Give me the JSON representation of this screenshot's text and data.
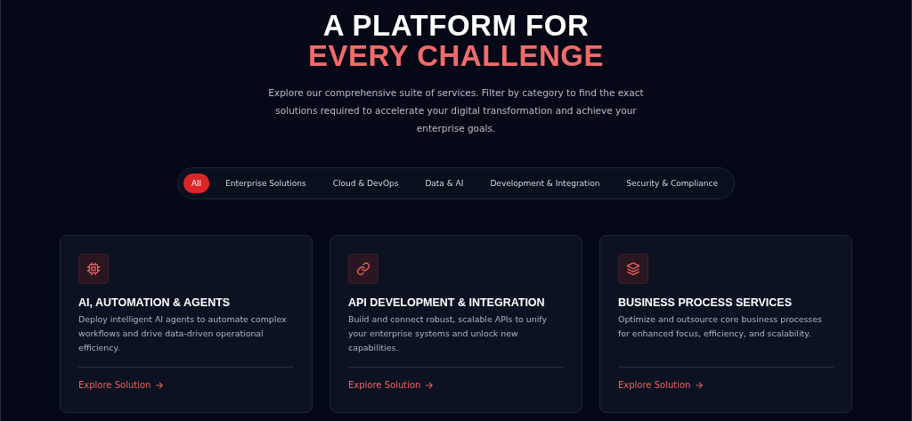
{
  "heading": {
    "line_1": "A PLATFORM FOR",
    "line_2": "EVERY CHALLENGE"
  },
  "intro": "Explore our comprehensive suite of services. Filter by category to find the exact solutions required to accelerate your digital transformation and achieve your enterprise goals.",
  "filters": [
    {
      "label": "All",
      "selected": true
    },
    {
      "label": "Enterprise Solutions",
      "selected": false
    },
    {
      "label": "Cloud & DevOps",
      "selected": false
    },
    {
      "label": "Data & AI",
      "selected": false
    },
    {
      "label": "Development & Integration",
      "selected": false
    },
    {
      "label": "Security & Compliance",
      "selected": false
    }
  ],
  "cards": [
    {
      "title": "AI, AUTOMATION & AGENTS",
      "description": "Deploy intelligent AI agents to automate complex workflows and drive data-driven operational efficiency.",
      "link": "Explore Solution"
    },
    {
      "title": "API DEVELOPMENT & INTEGRATION",
      "description": "Build and connect robust, scalable APIs to unify your enterprise systems and unlock new capabilities.",
      "link": "Explore Solution"
    },
    {
      "title": "BUSINESS PROCESS SERVICES",
      "description": "Optimize and outsource core business processes for enhanced focus, efficiency, and scalability.",
      "link": "Explore Solution"
    }
  ]
}
